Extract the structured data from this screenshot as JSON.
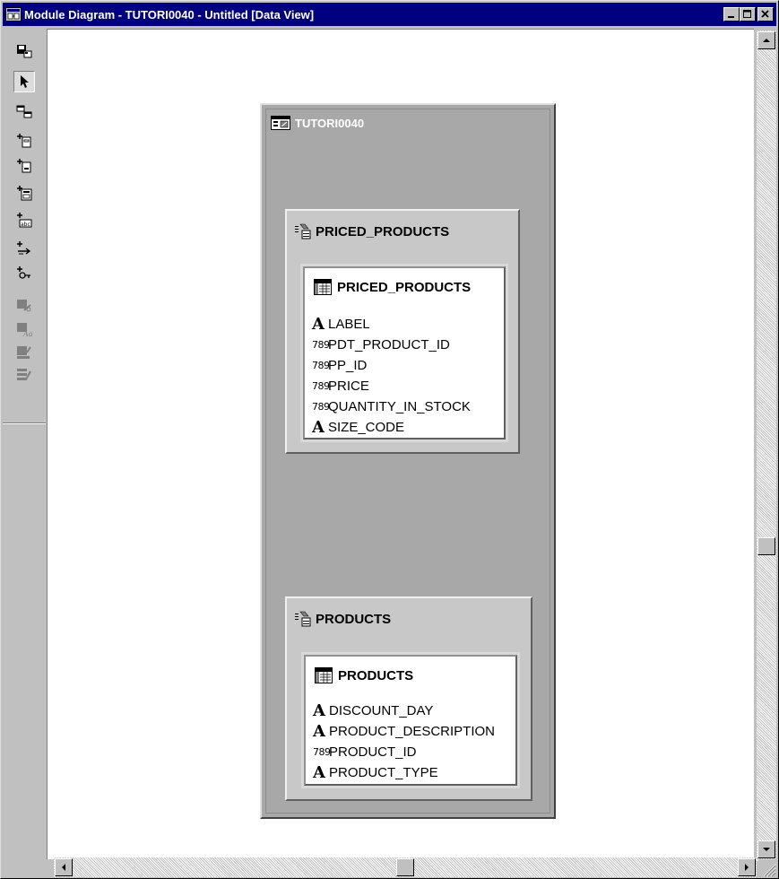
{
  "window": {
    "title": "Module Diagram - TUTORI0040 - Untitled [Data View]",
    "icon": "module-diagram-icon",
    "controls": {
      "minimize": "minimize-icon",
      "maximize": "maximize-icon",
      "close": "close-icon"
    }
  },
  "toolbar": {
    "tools": [
      {
        "name": "save-diagram-icon",
        "active": false
      },
      {
        "name": "select-pointer-icon",
        "active": true
      },
      {
        "name": "create-block-icon",
        "active": false
      },
      {
        "name": "create-base-table-usage-icon",
        "active": false
      },
      {
        "name": "create-lookup-usage-icon",
        "active": false
      },
      {
        "name": "create-item-group-icon",
        "active": false
      },
      {
        "name": "create-unbound-item-icon",
        "active": false
      },
      {
        "name": "create-link-icon",
        "active": false
      },
      {
        "name": "create-key-based-link-icon",
        "active": false
      },
      {
        "name": "disabled-tool-1-icon",
        "active": false
      },
      {
        "name": "disabled-tool-2-icon",
        "active": false
      },
      {
        "name": "disabled-tool-3-icon",
        "active": false
      },
      {
        "name": "disabled-tool-4-icon",
        "active": false
      }
    ]
  },
  "diagram": {
    "module": {
      "name": "TUTORI0040",
      "groups": [
        {
          "block_name": "PRICED_PRODUCTS",
          "table_name": "PRICED_PRODUCTS",
          "columns": [
            {
              "type": "alpha",
              "icon_text": "A",
              "name": "LABEL"
            },
            {
              "type": "num",
              "icon_text": "789",
              "name": "PDT_PRODUCT_ID"
            },
            {
              "type": "num",
              "icon_text": "789",
              "name": "PP_ID"
            },
            {
              "type": "num",
              "icon_text": "789",
              "name": "PRICE"
            },
            {
              "type": "num",
              "icon_text": "789",
              "name": "QUANTITY_IN_STOCK"
            },
            {
              "type": "alpha",
              "icon_text": "A",
              "name": "SIZE_CODE"
            }
          ]
        },
        {
          "block_name": "PRODUCTS",
          "table_name": "PRODUCTS",
          "columns": [
            {
              "type": "alpha",
              "icon_text": "A",
              "name": "DISCOUNT_DAY"
            },
            {
              "type": "alpha",
              "icon_text": "A",
              "name": "PRODUCT_DESCRIPTION"
            },
            {
              "type": "num",
              "icon_text": "789",
              "name": "PRODUCT_ID"
            },
            {
              "type": "alpha",
              "icon_text": "A",
              "name": "PRODUCT_TYPE"
            }
          ]
        }
      ]
    }
  },
  "scrollbars": {
    "vertical": {
      "position": 0.63
    },
    "horizontal": {
      "position": 0.5
    }
  }
}
